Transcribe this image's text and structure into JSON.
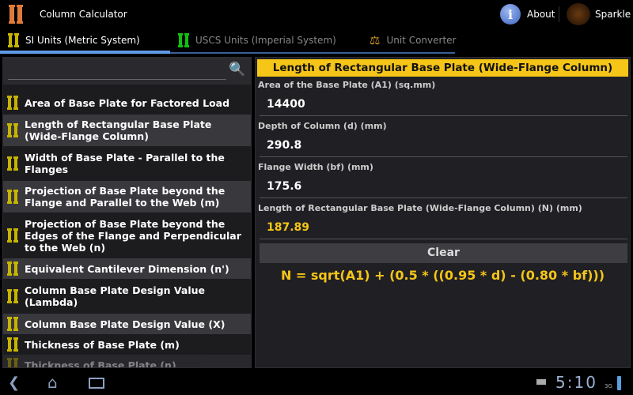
{
  "app": {
    "title": "Column Calculator",
    "about_label": "About",
    "sparkle_label": "Sparkle",
    "sparkle_logo_text": "SPARKLE"
  },
  "tabs": [
    {
      "label": "SI Units (Metric System)",
      "icon_color": "#c8b400",
      "selected": true
    },
    {
      "label": "USCS Units (Imperial System)",
      "icon_color": "#10c010",
      "selected": false
    },
    {
      "label": "Unit Converter",
      "icon_color": "#d0a020",
      "selected": false
    }
  ],
  "search": {
    "placeholder": "",
    "value": ""
  },
  "list": [
    {
      "label": "Area of Base Plate for Factored Load"
    },
    {
      "label": "Length of Rectangular Base Plate (Wide-Flange Column)"
    },
    {
      "label": "Width of Base Plate - Parallel to the Flanges"
    },
    {
      "label": "Projection of Base Plate beyond the Flange and Parallel to the Web (m)"
    },
    {
      "label": "Projection of Base Plate beyond the Edges of the Flange and Perpendicular to the Web (n)"
    },
    {
      "label": "Equivalent Cantilever Dimension (n')"
    },
    {
      "label": "Column Base Plate Design Value (Lambda)"
    },
    {
      "label": "Column Base Plate Design Value (X)"
    },
    {
      "label": "Thickness of Base Plate (m)"
    },
    {
      "label": "Thickness of Base Plate (n)"
    }
  ],
  "calc": {
    "title": "Length of Rectangular Base Plate (Wide-Flange Column)",
    "fields": [
      {
        "label": "Area of the Base Plate (A1) (sq.mm)",
        "value": "14400"
      },
      {
        "label": "Depth of Column (d) (mm)",
        "value": "290.8"
      },
      {
        "label": "Flange Width (bf) (mm)",
        "value": "175.6"
      },
      {
        "label": "Length of Rectangular Base Plate (Wide-Flange Column) (N) (mm)",
        "value": "187.89"
      }
    ],
    "clear_label": "Clear",
    "formula": "N = sqrt(A1) + (0.5 * ((0.95 * d) - (0.80 * bf)))"
  },
  "status": {
    "time": "5:10",
    "network": "3G"
  },
  "colors": {
    "accent": "#f5c518",
    "tab_indicator": "#5f9be6",
    "result": "#f5c518"
  }
}
